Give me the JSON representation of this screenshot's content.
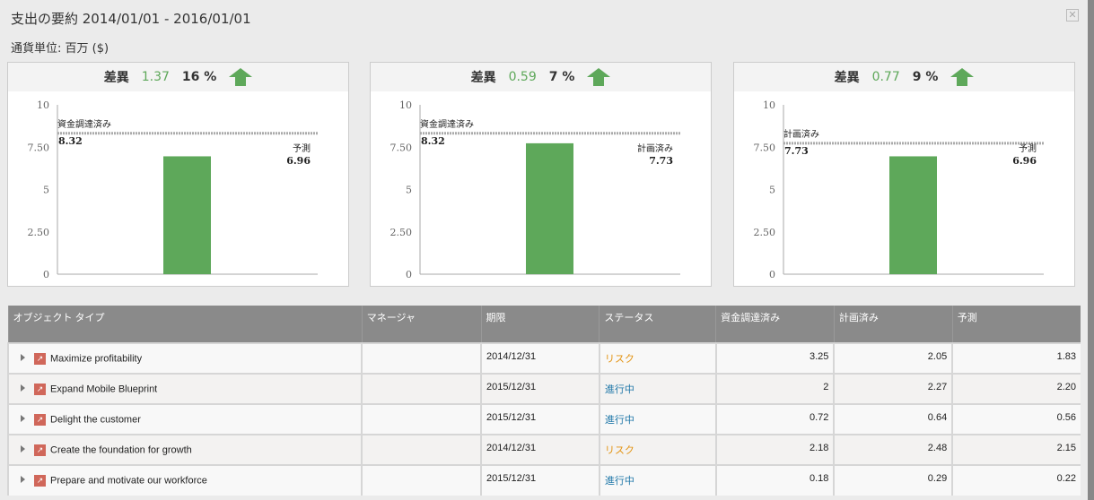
{
  "title": "支出の要約 2014/01/01 - 2016/01/01",
  "unit": "通貨単位: 百万 ($)",
  "colors": {
    "bar": "#5ea85a",
    "accent": "#5ea85a"
  },
  "panels": [
    {
      "diff_label": "差異",
      "diff": "1.37",
      "pct": "16 %",
      "ref_label": "資金調達済み",
      "ref_value": 8.32,
      "ref_text": "8.32",
      "bar_label": "予測",
      "bar_value": 6.96,
      "bar_text": "6.96"
    },
    {
      "diff_label": "差異",
      "diff": "0.59",
      "pct": "7 %",
      "ref_label": "資金調達済み",
      "ref_value": 8.32,
      "ref_text": "8.32",
      "bar_label": "計画済み",
      "bar_value": 7.73,
      "bar_text": "7.73"
    },
    {
      "diff_label": "差異",
      "diff": "0.77",
      "pct": "9 %",
      "ref_label": "計画済み",
      "ref_value": 7.73,
      "ref_text": "7.73",
      "bar_label": "予測",
      "bar_value": 6.96,
      "bar_text": "6.96"
    }
  ],
  "y_ticks": [
    "0",
    "2.50",
    "5",
    "7.50",
    "10"
  ],
  "table": {
    "headers": [
      "オブジェクト タイプ",
      "マネージャ",
      "期限",
      "ステータス",
      "資金調達済み",
      "計画済み",
      "予測"
    ],
    "rows": [
      {
        "name": "Maximize profitability",
        "manager": "",
        "due": "2014/12/31",
        "status": "リスク",
        "st": "risk",
        "funded": "3.25",
        "planned": "2.05",
        "forecast": "1.83"
      },
      {
        "name": "Expand Mobile Blueprint",
        "manager": "",
        "due": "2015/12/31",
        "status": "進行中",
        "st": "prog",
        "funded": "2",
        "planned": "2.27",
        "forecast": "2.20"
      },
      {
        "name": "Delight the customer",
        "manager": "",
        "due": "2015/12/31",
        "status": "進行中",
        "st": "prog",
        "funded": "0.72",
        "planned": "0.64",
        "forecast": "0.56"
      },
      {
        "name": "Create the foundation for growth",
        "manager": "",
        "due": "2014/12/31",
        "status": "リスク",
        "st": "risk",
        "funded": "2.18",
        "planned": "2.48",
        "forecast": "2.15"
      },
      {
        "name": "Prepare and motivate our workforce",
        "manager": "",
        "due": "2015/12/31",
        "status": "進行中",
        "st": "prog",
        "funded": "0.18",
        "planned": "0.29",
        "forecast": "0.22"
      }
    ]
  }
}
